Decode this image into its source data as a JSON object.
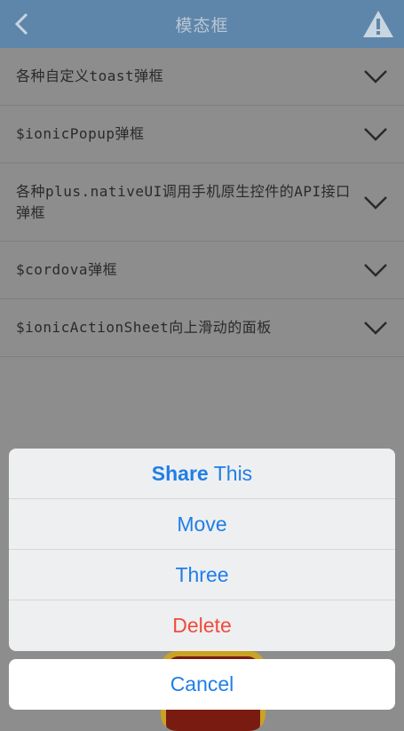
{
  "header": {
    "title": "模态框",
    "back_icon": "chevron-left-icon",
    "warning_icon": "warning-triangle-icon"
  },
  "list": {
    "items": [
      {
        "label": "各种自定义toast弹框"
      },
      {
        "label": "$ionicPopup弹框"
      },
      {
        "label": "各种plus.nativeUI调用手机原生控件的API接口弹框"
      },
      {
        "label": "$cordova弹框"
      },
      {
        "label": "$ionicActionSheet向上滑动的面板"
      }
    ]
  },
  "action_sheet": {
    "share_bold": "Share",
    "share_rest": "This",
    "move": "Move",
    "three": "Three",
    "delete": "Delete",
    "cancel": "Cancel"
  },
  "colors": {
    "header_bg": "#5e86ab",
    "action_blue": "#1f7ee8",
    "destructive_red": "#f04b3e"
  }
}
